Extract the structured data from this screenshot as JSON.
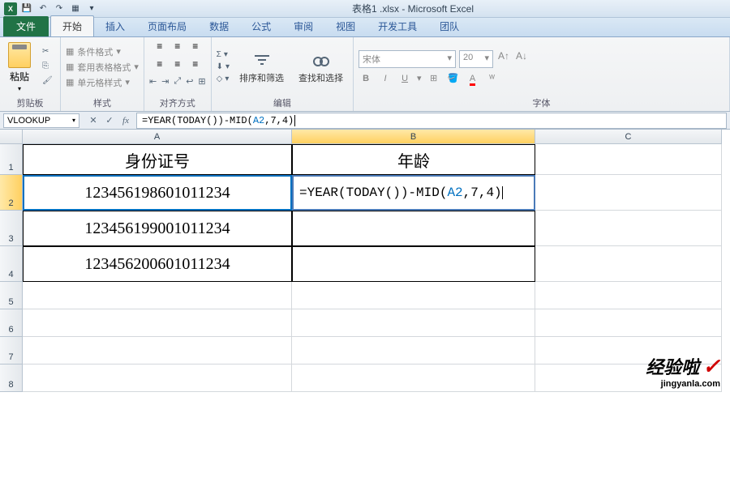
{
  "title": "表格1 .xlsx - Microsoft Excel",
  "qat": {
    "save": "💾",
    "undo": "↶",
    "redo": "↷",
    "new": "▦"
  },
  "tabs": {
    "file": "文件",
    "home": "开始",
    "insert": "插入",
    "layout": "页面布局",
    "data": "数据",
    "formulas": "公式",
    "review": "审阅",
    "view": "视图",
    "developer": "开发工具",
    "team": "团队"
  },
  "ribbon": {
    "clipboard": {
      "label": "剪贴板",
      "paste": "粘贴"
    },
    "styles": {
      "label": "样式",
      "conditional": "条件格式",
      "table": "套用表格格式",
      "cell": "单元格样式"
    },
    "align": {
      "label": "对齐方式"
    },
    "edit": {
      "label": "编辑",
      "sort": "排序和筛选",
      "find": "查找和选择"
    },
    "font": {
      "label": "字体",
      "name": "宋体",
      "size": "20",
      "bold": "B",
      "italic": "I",
      "underline": "U"
    }
  },
  "formula_bar": {
    "name_box": "VLOOKUP",
    "formula_display": "=YEAR(TODAY())-MID(A2,7,4)"
  },
  "columns": {
    "A": "A",
    "B": "B",
    "C": "C"
  },
  "rows": [
    "1",
    "2",
    "3",
    "4",
    "5",
    "6",
    "7",
    "8"
  ],
  "cells": {
    "A1": "身份证号",
    "B1": "年龄",
    "A2": "123456198601011234",
    "B2": "=YEAR(TODAY())-MID(A2,7,4)",
    "A3": "123456199001011234",
    "A4": "123456200601011234"
  },
  "watermark": {
    "big": "经验啦",
    "check": "✓",
    "small": "jingyanla.com"
  }
}
